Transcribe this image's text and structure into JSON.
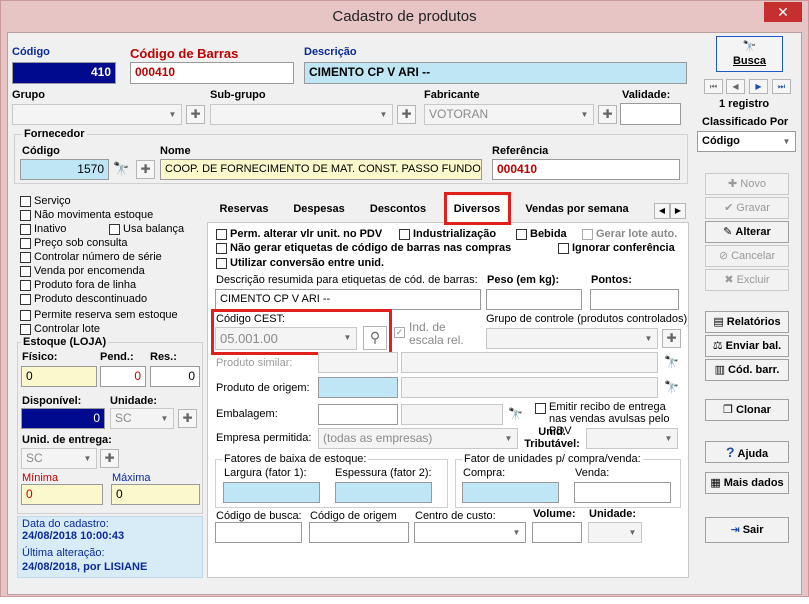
{
  "window": {
    "title": "Cadastro de produtos",
    "close": "✕"
  },
  "header": {
    "codigo_label": "Código",
    "codigo": "410",
    "barras_label": "Código de Barras",
    "barras": "000410",
    "descricao_label": "Descrição",
    "descricao": "CIMENTO CP V ARI --"
  },
  "row2": {
    "grupo_label": "Grupo",
    "subgrupo_label": "Sub-grupo",
    "fabricante_label": "Fabricante",
    "fabricante": "VOTORAN",
    "validade_label": "Validade:"
  },
  "fornecedor": {
    "title": "Fornecedor",
    "codigo_label": "Código",
    "codigo": "1570",
    "nome_label": "Nome",
    "nome": "COOP. DE FORNECIMENTO DE MAT. CONST. PASSO FUNDO",
    "ref_label": "Referência",
    "referencia": "000410"
  },
  "left_checks": [
    "Serviço",
    "Não movimenta estoque",
    "Inativo",
    "Usa balança",
    "Preço sob consulta",
    "Controlar número de série",
    "Venda por encomenda",
    "Produto fora de linha",
    "Produto descontinuado",
    "Permite reserva sem estoque",
    "Controlar lote"
  ],
  "estoque": {
    "title": "Estoque (LOJA)",
    "fisico_label": "Físico:",
    "fisico": "0",
    "pend_label": "Pend.:",
    "pend": "0",
    "res_label": "Res.:",
    "res": "0",
    "disp_label": "Disponível:",
    "disp": "0",
    "unid_label": "Unidade:",
    "unid": "SC",
    "entrega_label": "Unid. de entrega:",
    "entrega": "SC",
    "min_label": "Mínima",
    "min": "0",
    "max_label": "Máxima",
    "max": "0"
  },
  "footer": {
    "cad_label": "Data do cadastro:",
    "cad": "24/08/2018 10:00:43",
    "alt_label": "Última alteração:",
    "alt": "24/08/2018, por LISIANE"
  },
  "tabs": [
    "Reservas",
    "Despesas",
    "Descontos",
    "Diversos",
    "Vendas por semana"
  ],
  "diversos": {
    "checks": [
      "Perm. alterar vlr unit. no PDV",
      "Industrialização",
      "Bebida",
      "Gerar lote auto.",
      "Não gerar etiquetas de código de barras nas compras",
      "Ignorar conferência",
      "Utilizar conversão entre unid."
    ],
    "desc_label": "Descrição resumida para etiquetas de cód. de barras:",
    "desc": "CIMENTO CP V ARI --",
    "peso_label": "Peso (em kg):",
    "pontos_label": "Pontos:",
    "cest_label": "Código CEST:",
    "cest": "05.001.00",
    "ind_label": "Ind. de escala rel.",
    "grupo_ctrl_label": "Grupo de controle (produtos controlados)",
    "similar_label": "Produto similar:",
    "origem_label": "Produto de origem:",
    "embalagem_label": "Embalagem:",
    "recibo_label": "Emitir recibo de entrega nas vendas avulsas pelo PDV",
    "empresa_label": "Empresa permitida:",
    "empresa": "(todas as empresas)",
    "trib_label": "Unid. Tributável:",
    "fatores_title": "Fatores de baixa de estoque:",
    "largura_label": "Largura (fator 1):",
    "espessura_label": "Espessura (fator 2):",
    "fator_un_title": "Fator de unidades p/ compra/venda:",
    "compra_label": "Compra:",
    "venda_label": "Venda:",
    "busca_label": "Código de busca:",
    "cod_origem_label": "Código de origem",
    "centro_label": "Centro de custo:",
    "volume_label": "Volume:",
    "unidade_label": "Unidade:"
  },
  "right": {
    "busca": "Busca",
    "registros": "1 registro",
    "classificado": "Classificado Por",
    "classificado_val": "Código",
    "buttons": [
      "Novo",
      "Gravar",
      "Alterar",
      "Cancelar",
      "Excluir",
      "Relatórios",
      "Enviar bal.",
      "Cód. barr.",
      "Clonar",
      "Ajuda",
      "Mais dados",
      "Sair"
    ]
  }
}
